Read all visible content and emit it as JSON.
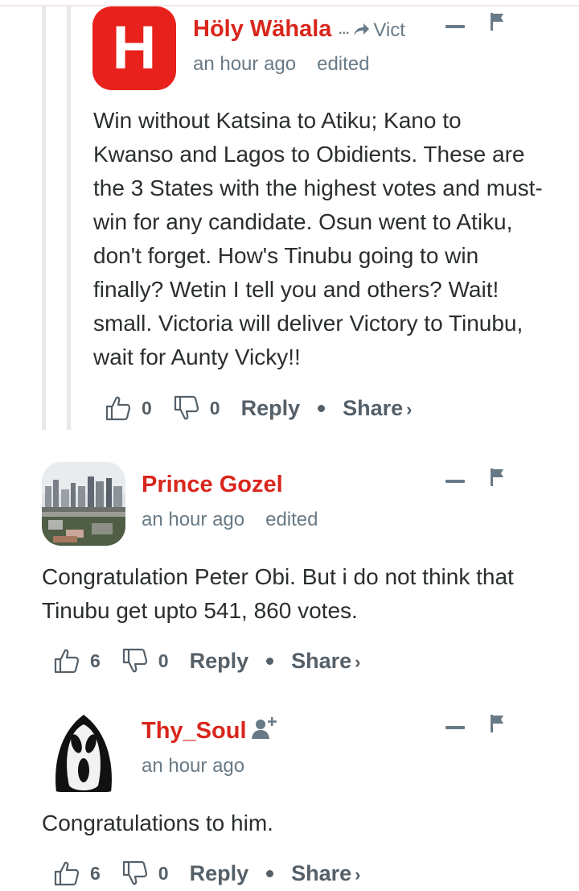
{
  "comments": [
    {
      "author": "Höly Wähala",
      "avatar_letter": "H",
      "reply_to": "Vict",
      "reply_ellipsis": "...",
      "time": "an hour ago",
      "edited": "edited",
      "text": "Win without Katsina to Atiku; Kano to Kwanso and Lagos to Obidients. These are the 3 States with the highest votes and must-win for any candidate. Osun went to Atiku, don't forget. How's Tinubu going to win finally? Wetin I tell you and others? Wait! small. Victoria will deliver Victory to Tinubu, wait for Aunty Vicky!!",
      "upvotes": "0",
      "downvotes": "0",
      "reply_label": "Reply",
      "share_label": "Share",
      "share_chevron": "›"
    },
    {
      "author": "Prince Gozel",
      "time": "an hour ago",
      "edited": "edited",
      "text": "Congratulation Peter Obi. But i do not think that Tinubu get upto 541, 860 votes.",
      "upvotes": "6",
      "downvotes": "0",
      "reply_label": "Reply",
      "share_label": "Share",
      "share_chevron": "›"
    },
    {
      "author": "Thy_Soul",
      "time": "an hour ago",
      "text": "Congratulations to him.",
      "upvotes": "6",
      "downvotes": "0",
      "reply_label": "Reply",
      "share_label": "Share",
      "share_chevron": "›"
    }
  ],
  "colors": {
    "author": "#d9261c",
    "meta": "#687a86",
    "text": "#2a2e2e",
    "avatar_bg": "#e8211c"
  }
}
